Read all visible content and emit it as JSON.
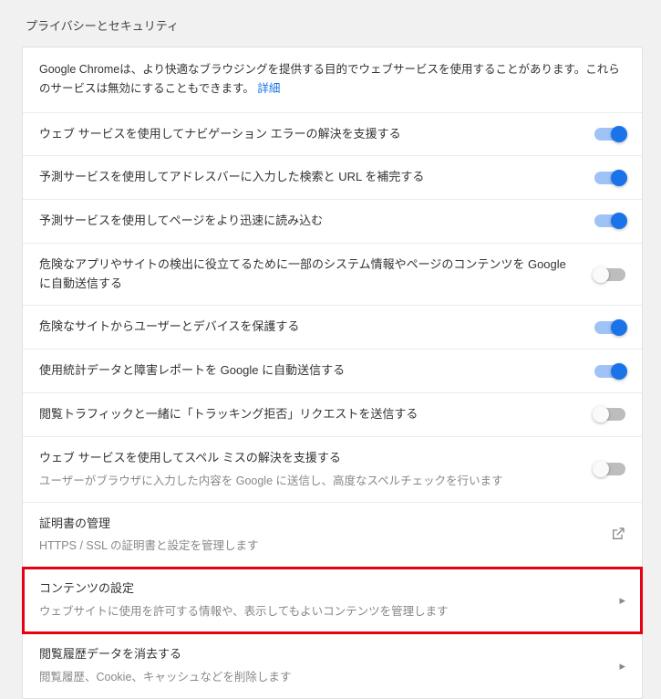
{
  "section": {
    "title": "プライバシーとセキュリティ"
  },
  "intro": {
    "text": "Google Chromeは、より快適なブラウジングを提供する目的でウェブサービスを使用することがあります。これらのサービスは無効にすることもできます。",
    "link": "詳細"
  },
  "rows": [
    {
      "label": "ウェブ サービスを使用してナビゲーション エラーの解決を支援する",
      "toggle": true
    },
    {
      "label": "予測サービスを使用してアドレスバーに入力した検索と URL を補完する",
      "toggle": true
    },
    {
      "label": "予測サービスを使用してページをより迅速に読み込む",
      "toggle": true
    },
    {
      "label": "危険なアプリやサイトの検出に役立てるために一部のシステム情報やページのコンテンツを Google に自動送信する",
      "toggle": false
    },
    {
      "label": "危険なサイトからユーザーとデバイスを保護する",
      "toggle": true
    },
    {
      "label": "使用統計データと障害レポートを Google に自動送信する",
      "toggle": true
    },
    {
      "label": "閲覧トラフィックと一緒に「トラッキング拒否」リクエストを送信する",
      "toggle": false
    },
    {
      "label": "ウェブ サービスを使用してスペル ミスの解決を支援する",
      "sub": "ユーザーがブラウザに入力した内容を Google に送信し、高度なスペルチェックを行います",
      "toggle": false
    }
  ],
  "links": [
    {
      "label": "証明書の管理",
      "sub": "HTTPS / SSL の証明書と設定を管理します",
      "icon": "external"
    },
    {
      "label": "コンテンツの設定",
      "sub": "ウェブサイトに使用を許可する情報や、表示してもよいコンテンツを管理します",
      "icon": "arrow",
      "highlight": true
    },
    {
      "label": "閲覧履歴データを消去する",
      "sub": "閲覧履歴、Cookie、キャッシュなどを削除します",
      "icon": "arrow"
    }
  ]
}
